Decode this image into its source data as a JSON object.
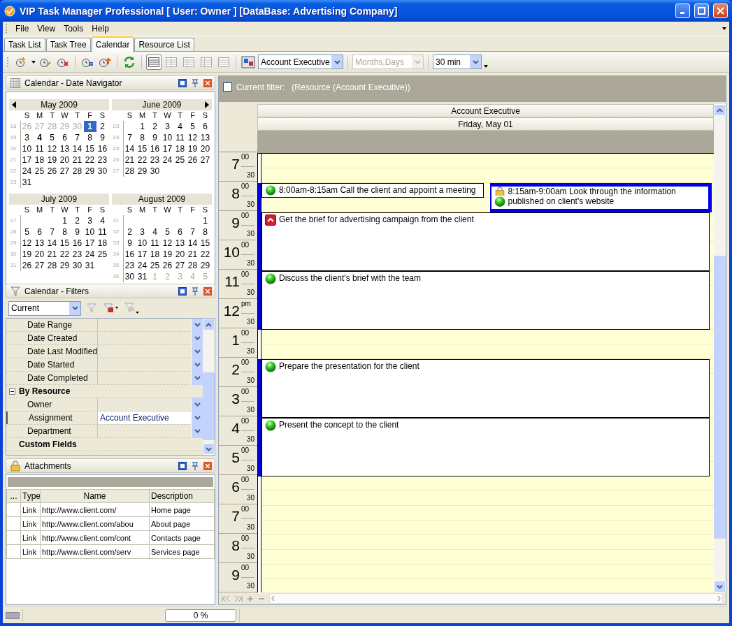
{
  "window": {
    "title": "VIP Task Manager Professional [ User: Owner ] [DataBase: Advertising Company]"
  },
  "menu": [
    "File",
    "View",
    "Tools",
    "Help"
  ],
  "tabs": [
    {
      "label": "Task List",
      "selected": false
    },
    {
      "label": "Task Tree",
      "selected": false
    },
    {
      "label": "Calendar",
      "selected": true
    },
    {
      "label": "Resource List",
      "selected": false
    }
  ],
  "toolbar": {
    "view_buttons": [
      {
        "selected": true
      },
      {
        "selected": false
      },
      {
        "selected": false
      },
      {
        "selected": false
      },
      {
        "selected": false
      }
    ],
    "resource": "Account Executive",
    "scale": {
      "value": "Months,Days",
      "disabled": true
    },
    "time_scale": "30 min"
  },
  "date_navigator": {
    "title": "Calendar - Date Navigator",
    "months": [
      {
        "title": "May 2009",
        "weekdays": [
          "S",
          "M",
          "T",
          "W",
          "T",
          "F",
          "S"
        ],
        "weeks": [
          {
            "number": "18",
            "days": [
              {
                "d": "26",
                "kind": "other"
              },
              {
                "d": "27",
                "kind": "other"
              },
              {
                "d": "28",
                "kind": "other"
              },
              {
                "d": "29",
                "kind": "other"
              },
              {
                "d": "30",
                "kind": "other"
              },
              {
                "d": "1",
                "kind": "selected"
              },
              {
                "d": "2",
                "kind": "plain"
              }
            ]
          },
          {
            "number": "19",
            "days": [
              {
                "d": "3",
                "kind": "plain"
              },
              {
                "d": "4",
                "kind": "bold"
              },
              {
                "d": "5",
                "kind": "plain"
              },
              {
                "d": "6",
                "kind": "plain"
              },
              {
                "d": "7",
                "kind": "plain"
              },
              {
                "d": "8",
                "kind": "plain"
              },
              {
                "d": "9",
                "kind": "plain"
              }
            ]
          },
          {
            "number": "20",
            "days": [
              {
                "d": "10",
                "kind": "plain"
              },
              {
                "d": "11",
                "kind": "plain"
              },
              {
                "d": "12",
                "kind": "plain"
              },
              {
                "d": "13",
                "kind": "plain"
              },
              {
                "d": "14",
                "kind": "plain"
              },
              {
                "d": "15",
                "kind": "plain"
              },
              {
                "d": "16",
                "kind": "plain"
              }
            ]
          },
          {
            "number": "21",
            "days": [
              {
                "d": "17",
                "kind": "plain"
              },
              {
                "d": "18",
                "kind": "plain"
              },
              {
                "d": "19",
                "kind": "plain"
              },
              {
                "d": "20",
                "kind": "plain"
              },
              {
                "d": "21",
                "kind": "plain"
              },
              {
                "d": "22",
                "kind": "plain"
              },
              {
                "d": "23",
                "kind": "plain"
              }
            ]
          },
          {
            "number": "22",
            "days": [
              {
                "d": "24",
                "kind": "plain"
              },
              {
                "d": "25",
                "kind": "plain"
              },
              {
                "d": "26",
                "kind": "plain"
              },
              {
                "d": "27",
                "kind": "plain"
              },
              {
                "d": "28",
                "kind": "plain"
              },
              {
                "d": "29",
                "kind": "plain"
              },
              {
                "d": "30",
                "kind": "plain"
              }
            ]
          },
          {
            "number": "23",
            "days": [
              {
                "d": "31",
                "kind": "plain"
              }
            ]
          }
        ]
      },
      {
        "title": "June 2009",
        "weekdays": [
          "S",
          "M",
          "T",
          "W",
          "T",
          "F",
          "S"
        ],
        "weeks": [
          {
            "number": "23",
            "days": [
              {
                "kind": "blank"
              },
              {
                "d": "1",
                "kind": "plain"
              },
              {
                "d": "2",
                "kind": "plain"
              },
              {
                "d": "3",
                "kind": "plain"
              },
              {
                "d": "4",
                "kind": "plain"
              },
              {
                "d": "5",
                "kind": "plain"
              },
              {
                "d": "6",
                "kind": "plain"
              }
            ]
          },
          {
            "number": "24",
            "days": [
              {
                "d": "7",
                "kind": "plain"
              },
              {
                "d": "8",
                "kind": "plain"
              },
              {
                "d": "9",
                "kind": "plain"
              },
              {
                "d": "10",
                "kind": "plain"
              },
              {
                "d": "11",
                "kind": "plain"
              },
              {
                "d": "12",
                "kind": "plain"
              },
              {
                "d": "13",
                "kind": "plain"
              }
            ]
          },
          {
            "number": "25",
            "days": [
              {
                "d": "14",
                "kind": "plain"
              },
              {
                "d": "15",
                "kind": "plain"
              },
              {
                "d": "16",
                "kind": "plain"
              },
              {
                "d": "17",
                "kind": "plain"
              },
              {
                "d": "18",
                "kind": "plain"
              },
              {
                "d": "19",
                "kind": "plain"
              },
              {
                "d": "20",
                "kind": "plain"
              }
            ]
          },
          {
            "number": "26",
            "days": [
              {
                "d": "21",
                "kind": "plain"
              },
              {
                "d": "22",
                "kind": "plain"
              },
              {
                "d": "23",
                "kind": "plain"
              },
              {
                "d": "24",
                "kind": "plain"
              },
              {
                "d": "25",
                "kind": "plain"
              },
              {
                "d": "26",
                "kind": "plain"
              },
              {
                "d": "27",
                "kind": "plain"
              }
            ]
          },
          {
            "number": "27",
            "days": [
              {
                "d": "28",
                "kind": "plain"
              },
              {
                "d": "29",
                "kind": "plain"
              },
              {
                "d": "30",
                "kind": "plain"
              }
            ]
          }
        ]
      },
      {
        "title": "July 2009",
        "weekdays": [
          "S",
          "M",
          "T",
          "W",
          "T",
          "F",
          "S"
        ],
        "weeks": [
          {
            "number": "27",
            "days": [
              {
                "kind": "blank"
              },
              {
                "kind": "blank"
              },
              {
                "kind": "blank"
              },
              {
                "d": "1",
                "kind": "plain"
              },
              {
                "d": "2",
                "kind": "plain"
              },
              {
                "d": "3",
                "kind": "plain"
              },
              {
                "d": "4",
                "kind": "plain"
              }
            ]
          },
          {
            "number": "28",
            "days": [
              {
                "d": "5",
                "kind": "plain"
              },
              {
                "d": "6",
                "kind": "plain"
              },
              {
                "d": "7",
                "kind": "plain"
              },
              {
                "d": "8",
                "kind": "plain"
              },
              {
                "d": "9",
                "kind": "plain"
              },
              {
                "d": "10",
                "kind": "plain"
              },
              {
                "d": "11",
                "kind": "plain"
              }
            ]
          },
          {
            "number": "29",
            "days": [
              {
                "d": "12",
                "kind": "plain"
              },
              {
                "d": "13",
                "kind": "plain"
              },
              {
                "d": "14",
                "kind": "plain"
              },
              {
                "d": "15",
                "kind": "plain"
              },
              {
                "d": "16",
                "kind": "plain"
              },
              {
                "d": "17",
                "kind": "plain"
              },
              {
                "d": "18",
                "kind": "plain"
              }
            ]
          },
          {
            "number": "30",
            "days": [
              {
                "d": "19",
                "kind": "plain"
              },
              {
                "d": "20",
                "kind": "plain"
              },
              {
                "d": "21",
                "kind": "plain"
              },
              {
                "d": "22",
                "kind": "plain"
              },
              {
                "d": "23",
                "kind": "plain"
              },
              {
                "d": "24",
                "kind": "plain"
              },
              {
                "d": "25",
                "kind": "plain"
              }
            ]
          },
          {
            "number": "31",
            "days": [
              {
                "d": "26",
                "kind": "plain"
              },
              {
                "d": "27",
                "kind": "plain"
              },
              {
                "d": "28",
                "kind": "plain"
              },
              {
                "d": "29",
                "kind": "plain"
              },
              {
                "d": "30",
                "kind": "plain"
              },
              {
                "d": "31",
                "kind": "plain"
              }
            ]
          }
        ]
      },
      {
        "title": "August 2009",
        "weekdays": [
          "S",
          "M",
          "T",
          "W",
          "T",
          "F",
          "S"
        ],
        "weeks": [
          {
            "number": "31",
            "days": [
              {
                "kind": "blank"
              },
              {
                "kind": "blank"
              },
              {
                "kind": "blank"
              },
              {
                "kind": "blank"
              },
              {
                "kind": "blank"
              },
              {
                "kind": "blank"
              },
              {
                "d": "1",
                "kind": "plain"
              }
            ]
          },
          {
            "number": "32",
            "days": [
              {
                "d": "2",
                "kind": "plain"
              },
              {
                "d": "3",
                "kind": "plain"
              },
              {
                "d": "4",
                "kind": "plain"
              },
              {
                "d": "5",
                "kind": "plain"
              },
              {
                "d": "6",
                "kind": "plain"
              },
              {
                "d": "7",
                "kind": "plain"
              },
              {
                "d": "8",
                "kind": "plain"
              }
            ]
          },
          {
            "number": "33",
            "days": [
              {
                "d": "9",
                "kind": "plain"
              },
              {
                "d": "10",
                "kind": "plain"
              },
              {
                "d": "11",
                "kind": "plain"
              },
              {
                "d": "12",
                "kind": "plain"
              },
              {
                "d": "13",
                "kind": "plain"
              },
              {
                "d": "14",
                "kind": "plain"
              },
              {
                "d": "15",
                "kind": "plain"
              }
            ]
          },
          {
            "number": "34",
            "days": [
              {
                "d": "16",
                "kind": "plain"
              },
              {
                "d": "17",
                "kind": "plain"
              },
              {
                "d": "18",
                "kind": "plain"
              },
              {
                "d": "19",
                "kind": "plain"
              },
              {
                "d": "20",
                "kind": "plain"
              },
              {
                "d": "21",
                "kind": "plain"
              },
              {
                "d": "22",
                "kind": "plain"
              }
            ]
          },
          {
            "number": "35",
            "days": [
              {
                "d": "23",
                "kind": "plain"
              },
              {
                "d": "24",
                "kind": "plain"
              },
              {
                "d": "25",
                "kind": "plain"
              },
              {
                "d": "26",
                "kind": "plain"
              },
              {
                "d": "27",
                "kind": "plain"
              },
              {
                "d": "28",
                "kind": "plain"
              },
              {
                "d": "29",
                "kind": "plain"
              }
            ]
          },
          {
            "number": "36",
            "days": [
              {
                "d": "30",
                "kind": "plain"
              },
              {
                "d": "31",
                "kind": "plain"
              },
              {
                "d": "1",
                "kind": "other"
              },
              {
                "d": "2",
                "kind": "other"
              },
              {
                "d": "3",
                "kind": "other"
              },
              {
                "d": "4",
                "kind": "other"
              },
              {
                "d": "5",
                "kind": "other"
              }
            ]
          }
        ]
      }
    ]
  },
  "filters": {
    "title": "Calendar - Filters",
    "preset": "Current",
    "rows": [
      {
        "kind": "field",
        "label": "Date Range",
        "selected": false
      },
      {
        "kind": "field",
        "label": "Date Created",
        "selected": false
      },
      {
        "kind": "field",
        "label": "Date Last Modified",
        "selected": false
      },
      {
        "kind": "field",
        "label": "Date Started",
        "selected": false
      },
      {
        "kind": "field",
        "label": "Date Completed",
        "selected": false
      },
      {
        "kind": "group",
        "label": "By Resource",
        "expanded": true,
        "children": [
          {
            "kind": "field",
            "label": "Owner",
            "selected": false
          },
          {
            "kind": "field",
            "label": "Assignment",
            "value": "Account Executive",
            "selected": true
          },
          {
            "kind": "field",
            "label": "Department",
            "selected": false
          }
        ]
      },
      {
        "kind": "category",
        "label": "Custom Fields"
      }
    ]
  },
  "attachments": {
    "title": "Attachments",
    "columns": [
      "...",
      "Type",
      "Name",
      "Description"
    ],
    "rows": [
      [
        "",
        "Link",
        "http://www.client.com/",
        "Home page"
      ],
      [
        "",
        "Link",
        "http://www.client.com/abou",
        "About page"
      ],
      [
        "",
        "Link",
        "http://www.client.com/cont",
        "Contacts page"
      ],
      [
        "",
        "Link",
        "http://www.client.com/serv",
        "Services page"
      ]
    ]
  },
  "calendar": {
    "filter": {
      "checked": false,
      "label": "Current filter:",
      "value": "(Resource  (Account Executive))"
    },
    "resource": "Account Executive",
    "date": "Friday, May 01",
    "hours": [
      {
        "hour": "7",
        "mark": "00",
        "half": "30",
        "slots": [
          {
            "busy": false
          },
          {
            "busy": false
          }
        ]
      },
      {
        "hour": "8",
        "mark": "00",
        "half": "30",
        "slots": [
          {
            "busy": true
          },
          {
            "busy": true
          }
        ],
        "events": [
          {
            "time": "8:00am-8:15am",
            "title": "Call the client and appoint a meeting",
            "high_priority": false,
            "locked": false,
            "selected": false
          },
          {
            "time": "8:15am-9:00am",
            "title": "Look through the information published on client's website",
            "high_priority": false,
            "locked": true,
            "selected": true
          }
        ]
      },
      {
        "hour": "9",
        "mark": "00",
        "half": "30",
        "slots": [
          {
            "busy": true
          },
          {
            "busy": true
          }
        ],
        "events": [
          {
            "title": "Get the brief for advertising campaign from the client",
            "high_priority": true,
            "locked": false,
            "selected": false
          }
        ]
      },
      {
        "hour": "10",
        "mark": "00",
        "half": "30",
        "slots": [
          {
            "busy": true
          },
          {
            "busy": true
          }
        ]
      },
      {
        "hour": "11",
        "mark": "00",
        "half": "30",
        "slots": [
          {
            "busy": true
          },
          {
            "busy": true
          }
        ],
        "events": [
          {
            "title": "Discuss the client's brief with the team",
            "high_priority": false,
            "locked": false,
            "selected": false
          }
        ]
      },
      {
        "hour": "12",
        "mark": "pm",
        "half": "30",
        "slots": [
          {
            "busy": true
          },
          {
            "busy": true
          }
        ]
      },
      {
        "hour": "1",
        "mark": "00",
        "half": "30",
        "slots": [
          {
            "busy": false
          },
          {
            "busy": false
          }
        ]
      },
      {
        "hour": "2",
        "mark": "00",
        "half": "30",
        "slots": [
          {
            "busy": true
          },
          {
            "busy": true
          }
        ],
        "events": [
          {
            "title": "Prepare the presentation for the client",
            "high_priority": false,
            "locked": false,
            "selected": false
          }
        ]
      },
      {
        "hour": "3",
        "mark": "00",
        "half": "30",
        "slots": [
          {
            "busy": true
          },
          {
            "busy": true
          }
        ]
      },
      {
        "hour": "4",
        "mark": "00",
        "half": "30",
        "slots": [
          {
            "busy": true
          },
          {
            "busy": true
          }
        ],
        "events": [
          {
            "title": "Present the concept to the client",
            "high_priority": false,
            "locked": false,
            "selected": false
          }
        ]
      },
      {
        "hour": "5",
        "mark": "00",
        "half": "30",
        "slots": [
          {
            "busy": true
          },
          {
            "busy": true
          }
        ]
      },
      {
        "hour": "6",
        "mark": "00",
        "half": "30",
        "slots": [
          {
            "busy": false
          },
          {
            "busy": false
          }
        ]
      },
      {
        "hour": "7",
        "mark": "00",
        "half": "30",
        "slots": [
          {
            "busy": false
          },
          {
            "busy": false
          }
        ]
      },
      {
        "hour": "8",
        "mark": "00",
        "half": "30",
        "slots": [
          {
            "busy": false
          },
          {
            "busy": false
          }
        ]
      },
      {
        "hour": "9",
        "mark": "00",
        "half": "30",
        "slots": [
          {
            "busy": false
          },
          {
            "busy": false
          }
        ]
      }
    ]
  },
  "status_bar": {
    "progress": {
      "level": 0,
      "reading": "0 %"
    }
  }
}
